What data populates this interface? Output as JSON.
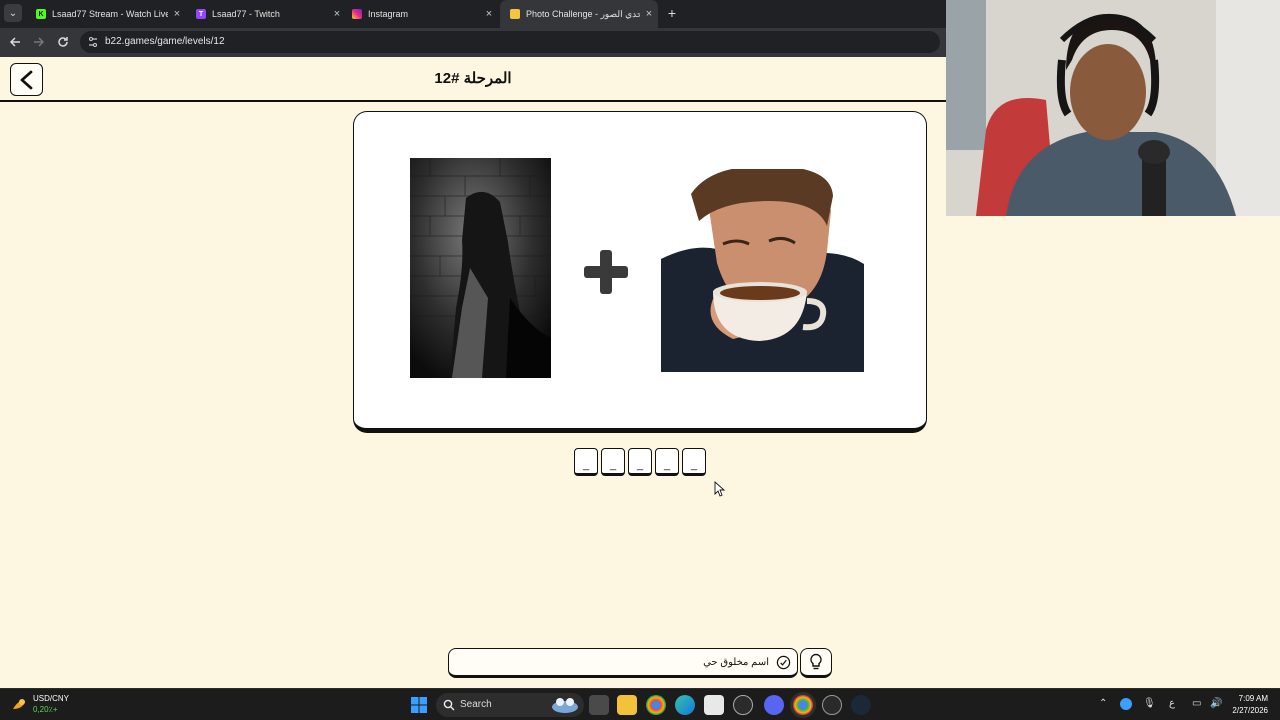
{
  "browser": {
    "tabs": [
      {
        "title": "Lsaad77 Stream - Watch Live on",
        "icon": "kick-icon",
        "color": "#53fc18",
        "active": false
      },
      {
        "title": "Lsaad77 - Twitch",
        "icon": "twitch-icon",
        "color": "#9146ff",
        "active": false
      },
      {
        "title": "Instagram",
        "icon": "instagram-icon",
        "color": "#e1306c",
        "active": false
      },
      {
        "title": "Photo Challenge - تحدي الصور",
        "icon": "game-icon",
        "color": "#f5c542",
        "active": true
      }
    ],
    "close_glyph": "×",
    "new_tab_glyph": "+",
    "url": "b22.games/game/levels/12"
  },
  "game": {
    "level_title": "المرحلة #12",
    "back_icon": "chevron-left-icon",
    "images": [
      {
        "name": "ghost-girl-photo",
        "description_icon": "ghost-photo"
      },
      {
        "name": "man-drinking-coffee-photo",
        "description_icon": "coffee-photo"
      }
    ],
    "operator": "+",
    "answer_slots": [
      "_",
      "_",
      "_",
      "_",
      "_"
    ],
    "hint": {
      "text": "اسم مخلوق حي",
      "icon": "check-circle-icon"
    },
    "hint_button_icon": "lightbulb-icon"
  },
  "taskbar": {
    "ticker_name": "USD/CNY",
    "ticker_value": "0,20٪+",
    "search_label": "Search",
    "language": "ع",
    "time": "7:09 AM",
    "date": "2/27/2026"
  },
  "colors": {
    "page_bg": "#fdf6e0",
    "chrome_dark": "#202124",
    "chrome_mid": "#35363a",
    "taskbar": "#1c1c1c"
  }
}
